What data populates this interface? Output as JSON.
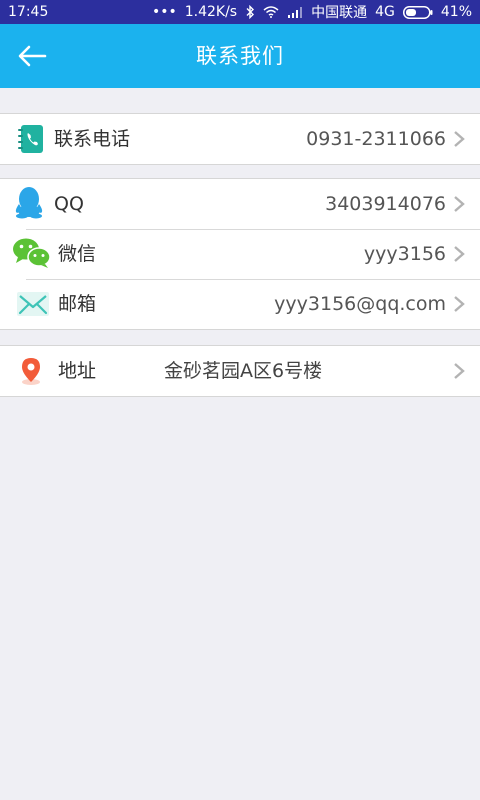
{
  "status_bar": {
    "time": "17:45",
    "dots": "•••",
    "speed": "1.42K/s",
    "carrier": "中国联通",
    "network": "4G",
    "battery": "41%",
    "icons": [
      "bluetooth-icon",
      "wifi-icon",
      "signal-icon",
      "battery-icon"
    ]
  },
  "header": {
    "title": "联系我们",
    "back_icon": "back-arrow-icon"
  },
  "groups": [
    {
      "rows": [
        {
          "icon": "phone-book-icon",
          "label": "联系电话",
          "value": "0931-2311066"
        }
      ]
    },
    {
      "rows": [
        {
          "icon": "qq-icon",
          "label": "QQ",
          "value": "3403914076"
        },
        {
          "icon": "wechat-icon",
          "label": "微信",
          "value": "yyy3156"
        },
        {
          "icon": "mail-icon",
          "label": "邮箱",
          "value": "yyy3156@qq.com"
        }
      ]
    },
    {
      "rows": [
        {
          "icon": "location-pin-icon",
          "label": "地址",
          "value": "金砂茗园A区6号楼"
        }
      ]
    }
  ],
  "colors": {
    "status_bar": "#2c2f9e",
    "app_bar": "#1bb2ee",
    "background": "#efeff4",
    "phone_icon": "#20b2a0",
    "qq_icon": "#2ba6e8",
    "wechat_icon": "#5bc235",
    "mail_icon": "#3ec4b7",
    "pin_icon": "#f25c3a"
  }
}
